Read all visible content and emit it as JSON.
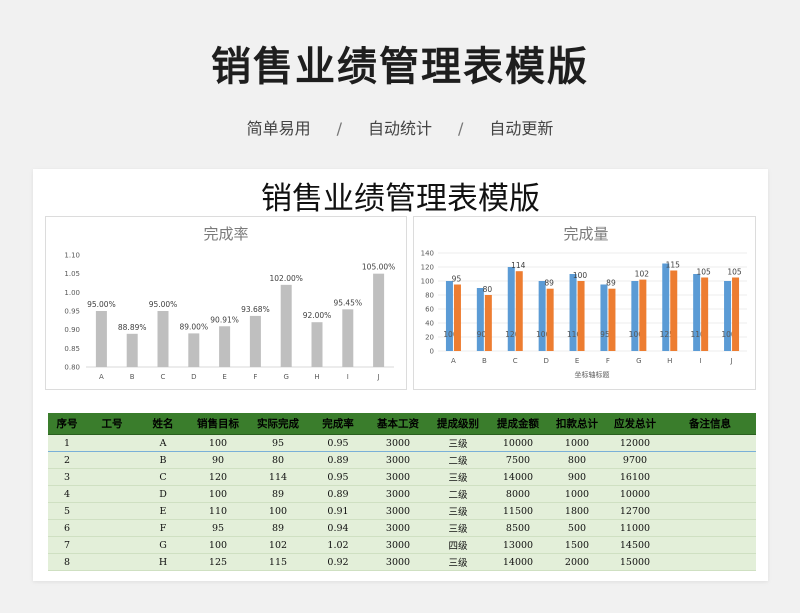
{
  "banner": {
    "title": "销售业绩管理表模版",
    "tags": [
      "简单易用",
      "自动统计",
      "自动更新"
    ],
    "separator": "/"
  },
  "sheet": {
    "title": "销售业绩管理表模版"
  },
  "colors": {
    "header_green": "#3a7d2c",
    "row_green": "#e3efd9",
    "bar_gray": "#bfbfbf",
    "bar_blue": "#5b9bd5",
    "bar_orange": "#ed7d31"
  },
  "chart_data": [
    {
      "type": "bar",
      "title": "完成率",
      "categories": [
        "A",
        "B",
        "C",
        "D",
        "E",
        "F",
        "G",
        "H",
        "I",
        "J"
      ],
      "values": [
        0.95,
        0.8889,
        0.95,
        0.89,
        0.9091,
        0.9368,
        1.02,
        0.92,
        0.9545,
        1.05
      ],
      "data_labels": [
        "95.00%",
        "88.89%",
        "95.00%",
        "89.00%",
        "90.91%",
        "93.68%",
        "102.00%",
        "92.00%",
        "95.45%",
        "105.00%"
      ],
      "yticks": [
        "0.80",
        "0.85",
        "0.90",
        "0.95",
        "1.00",
        "1.05",
        "1.10"
      ],
      "ylim": [
        0.8,
        1.1
      ],
      "grid": false
    },
    {
      "type": "bar",
      "title": "完成量",
      "xlabel": "坐标轴标题",
      "categories": [
        "A",
        "B",
        "C",
        "D",
        "E",
        "F",
        "G",
        "H",
        "I",
        "J"
      ],
      "series": [
        {
          "values": [
            100,
            90,
            120,
            100,
            110,
            95,
            100,
            125,
            110,
            100
          ]
        },
        {
          "values": [
            95,
            80,
            114,
            89,
            100,
            89,
            102,
            115,
            105,
            105
          ]
        }
      ],
      "yticks": [
        "0",
        "20",
        "40",
        "60",
        "80",
        "100",
        "120",
        "140"
      ],
      "ylim": [
        0,
        140
      ],
      "grid": true
    }
  ],
  "table": {
    "headers": [
      "序号",
      "工号",
      "姓名",
      "销售目标",
      "实际完成",
      "完成率",
      "基本工资",
      "提成级别",
      "提成金额",
      "扣款总计",
      "应发总计",
      "备注信息"
    ],
    "rows": [
      [
        "1",
        "",
        "A",
        "100",
        "95",
        "0.95",
        "3000",
        "三级",
        "10000",
        "1000",
        "12000",
        ""
      ],
      [
        "2",
        "",
        "B",
        "90",
        "80",
        "0.89",
        "3000",
        "二级",
        "7500",
        "800",
        "9700",
        ""
      ],
      [
        "3",
        "",
        "C",
        "120",
        "114",
        "0.95",
        "3000",
        "三级",
        "14000",
        "900",
        "16100",
        ""
      ],
      [
        "4",
        "",
        "D",
        "100",
        "89",
        "0.89",
        "3000",
        "二级",
        "8000",
        "1000",
        "10000",
        ""
      ],
      [
        "5",
        "",
        "E",
        "110",
        "100",
        "0.91",
        "3000",
        "三级",
        "11500",
        "1800",
        "12700",
        ""
      ],
      [
        "6",
        "",
        "F",
        "95",
        "89",
        "0.94",
        "3000",
        "三级",
        "8500",
        "500",
        "11000",
        ""
      ],
      [
        "7",
        "",
        "G",
        "100",
        "102",
        "1.02",
        "3000",
        "四级",
        "13000",
        "1500",
        "14500",
        ""
      ],
      [
        "8",
        "",
        "H",
        "125",
        "115",
        "0.92",
        "3000",
        "三级",
        "14000",
        "2000",
        "15000",
        ""
      ]
    ]
  }
}
